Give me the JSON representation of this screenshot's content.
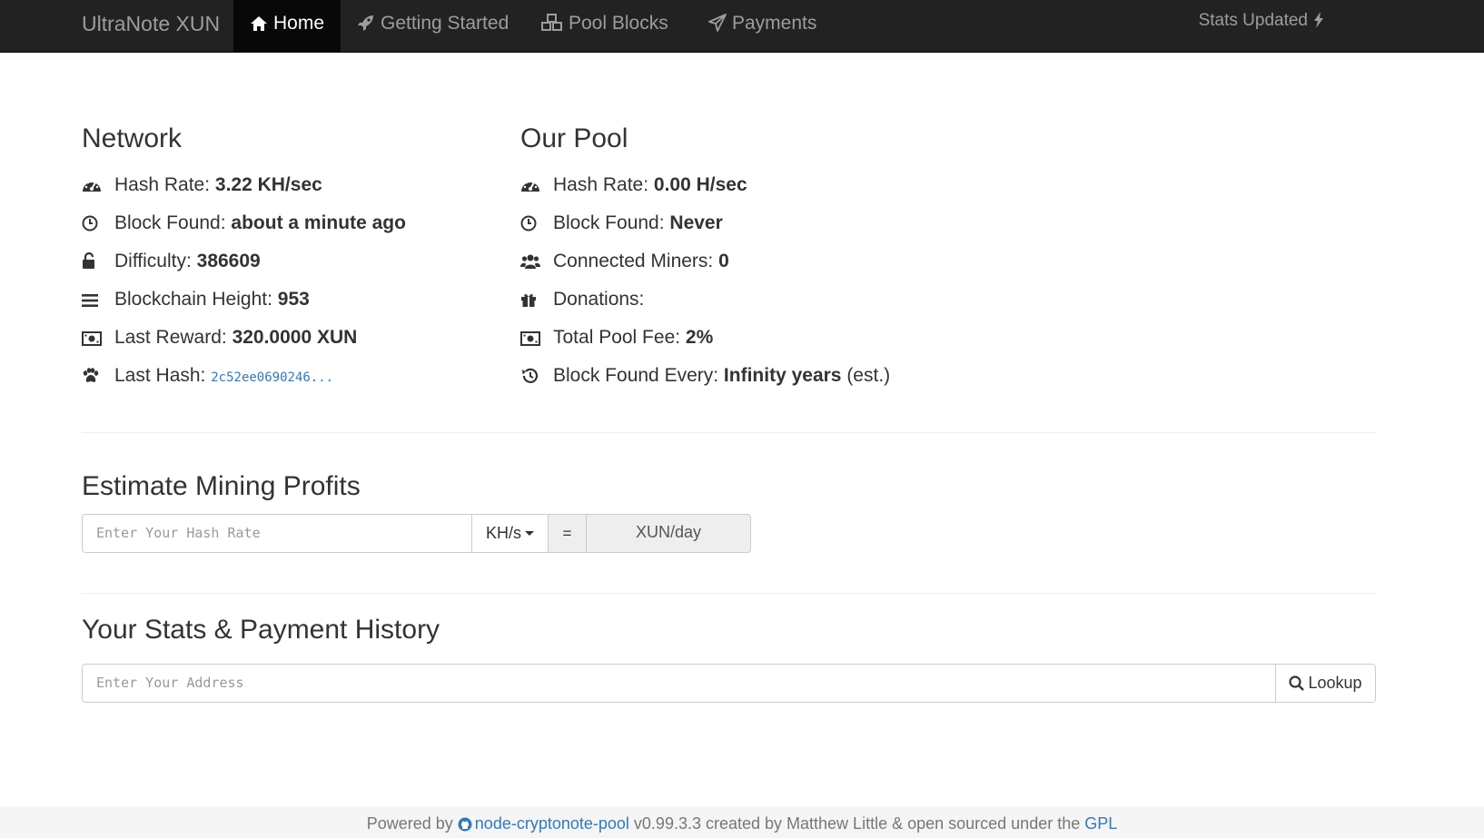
{
  "nav": {
    "brand": "UltraNote XUN",
    "items": [
      {
        "label": "Home",
        "icon": "home-icon",
        "active": true
      },
      {
        "label": "Getting Started",
        "icon": "rocket-icon"
      },
      {
        "label": "Pool Blocks",
        "icon": "cubes-icon"
      },
      {
        "label": "Payments",
        "icon": "paper-plane-icon"
      }
    ],
    "stats_updated": "Stats Updated"
  },
  "network": {
    "title": "Network",
    "hash_rate_label": "Hash Rate: ",
    "hash_rate": "3.22 KH/sec",
    "block_found_label": "Block Found: ",
    "block_found": "about a minute ago",
    "difficulty_label": "Difficulty: ",
    "difficulty": "386609",
    "height_label": "Blockchain Height: ",
    "height": "953",
    "reward_label": "Last Reward: ",
    "reward": "320.0000 XUN",
    "hash_label": "Last Hash: ",
    "hash": "2c52ee0690246..."
  },
  "pool": {
    "title": "Our Pool",
    "hash_rate_label": "Hash Rate: ",
    "hash_rate": "0.00 H/sec",
    "block_found_label": "Block Found: ",
    "block_found": "Never",
    "miners_label": "Connected Miners: ",
    "miners": "0",
    "donations_label": "Donations:",
    "fee_label": "Total Pool Fee: ",
    "fee": "2%",
    "every_label": "Block Found Every: ",
    "every": "Infinity years",
    "every_suffix": " (est.)"
  },
  "estimate": {
    "title": "Estimate Mining Profits",
    "placeholder": "Enter Your Hash Rate",
    "unit": "KH/s",
    "equals": "=",
    "result": "XUN/day"
  },
  "stats": {
    "title": "Your Stats & Payment History",
    "placeholder": "Enter Your Address",
    "lookup": "Lookup"
  },
  "footer": {
    "powered_by": "Powered by ",
    "project": "node-cryptonote-pool",
    "middle": " v0.99.3.3 created by Matthew Little & open sourced under the ",
    "license": "GPL"
  }
}
